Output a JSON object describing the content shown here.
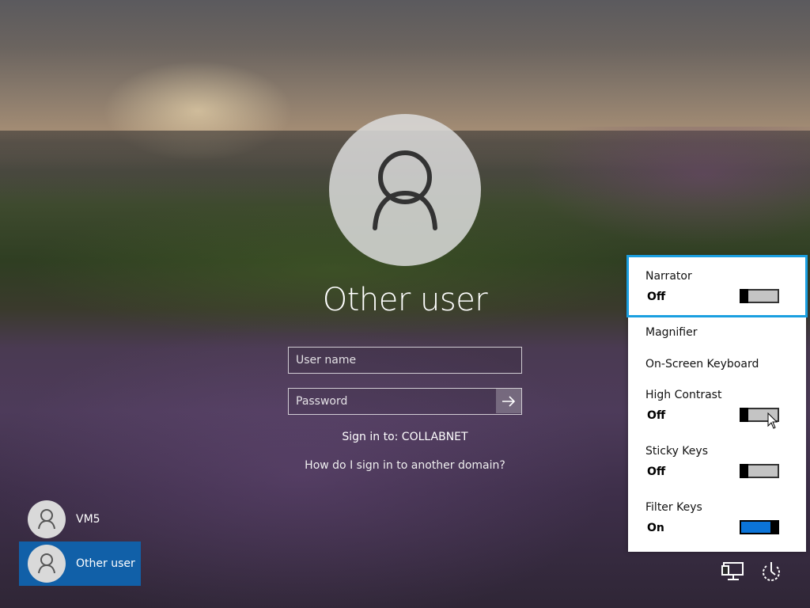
{
  "login": {
    "title": "Other user",
    "username_placeholder": "User name",
    "password_placeholder": "Password",
    "signin_to": "Sign in to: COLLABNET",
    "domain_help": "How do I sign in to another domain?"
  },
  "users": [
    {
      "label": "VM5",
      "selected": false
    },
    {
      "label": "Other user",
      "selected": true
    }
  ],
  "ease_of_access": {
    "items": [
      {
        "name": "Narrator",
        "state": "Off",
        "toggle": "off",
        "focused": true
      },
      {
        "name": "Magnifier"
      },
      {
        "name": "On-Screen Keyboard"
      },
      {
        "name": "High Contrast",
        "state": "Off",
        "toggle": "off"
      },
      {
        "name": "Sticky Keys",
        "state": "Off",
        "toggle": "off"
      },
      {
        "name": "Filter Keys",
        "state": "On",
        "toggle": "on"
      }
    ]
  },
  "tray": {
    "icons": [
      "network-icon",
      "power-icon"
    ]
  },
  "colors": {
    "accent": "#1160a8",
    "toggle_on": "#0b74d8",
    "focus": "#1a9fe0"
  }
}
